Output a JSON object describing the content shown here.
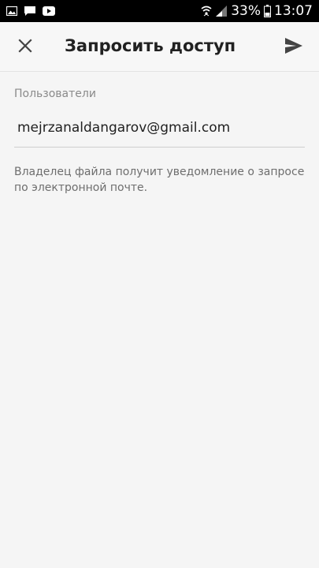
{
  "status_bar": {
    "notification_icons": [
      "image-icon",
      "chat-icon",
      "youtube-icon"
    ],
    "status_icons": [
      "wifi-icon",
      "signal-icon",
      "battery-icon"
    ],
    "battery": "33%",
    "time": "13:07"
  },
  "app_bar": {
    "title": "Запросить доступ",
    "close_icon": "close-icon",
    "send_icon": "send-icon"
  },
  "form": {
    "users_label": "Пользователи",
    "users_value": "mejrzanaldangarov@gmail.com",
    "hint": "Владелец файла получит уведомление о запросе по электронной почте."
  },
  "colors": {
    "status_bar_bg": "#000000",
    "background": "#f5f5f5",
    "title": "#212121",
    "label": "#8a8a8a",
    "hint": "#6e6e6e"
  }
}
